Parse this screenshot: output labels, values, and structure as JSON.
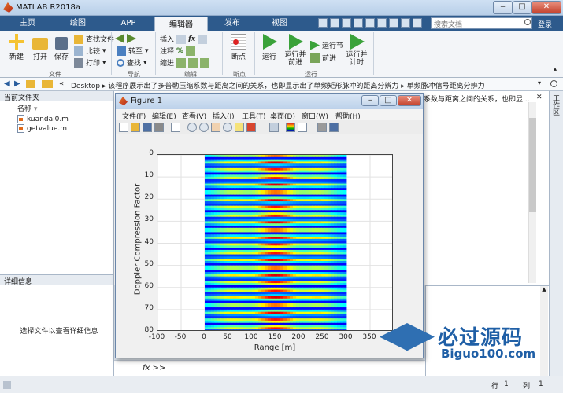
{
  "window": {
    "title": "MATLAB R2018a"
  },
  "tabs": [
    {
      "label": "主页"
    },
    {
      "label": "绘图"
    },
    {
      "label": "APP"
    },
    {
      "label": "编辑器"
    },
    {
      "label": "发布"
    },
    {
      "label": "视图"
    }
  ],
  "search": {
    "placeholder": "搜索文档"
  },
  "login": "登录",
  "ribbon": {
    "new": "新建",
    "open": "打开",
    "save": "保存",
    "find_files": "查找文件",
    "compare": "比较",
    "print": "打印",
    "goto": "转至",
    "find": "查找",
    "insert": "插入",
    "comment": "注释",
    "indent": "缩进",
    "breakpoints": "断点",
    "run": "运行",
    "run_advance": "运行并\n前进",
    "run_section": "运行节",
    "advance": "前进",
    "run_time": "运行并\n计时",
    "groups": {
      "file": "文件",
      "nav": "导航",
      "edit": "编辑",
      "bp": "断点",
      "run": "运行"
    }
  },
  "address": {
    "root": "Desktop",
    "seg1": "该程序展示出了多普勒压缩系数与距离之间的关系，也即显示出了单频矩形脉冲的距离分辨力",
    "seg2": "单频脉冲信号距离分辨力"
  },
  "left": {
    "title": "当前文件夹",
    "col_name": "名称",
    "files": [
      "kuandai0.m",
      "getvalue.m"
    ],
    "details_title": "详细信息",
    "details_hint": "选择文件以查看详细信息"
  },
  "editor_tail": "系数与距离之间的关系，也即显...",
  "sidebar_label": "工作区",
  "figure": {
    "title": "Figure 1",
    "menu": [
      "文件(F)",
      "编辑(E)",
      "查看(V)",
      "插入(I)",
      "工具(T)",
      "桌面(D)",
      "窗口(W)",
      "帮助(H)"
    ]
  },
  "chart_data": {
    "type": "heatmap",
    "xlabel": "Range [m]",
    "ylabel": "Doppler Compression Factor",
    "xlim": [
      -100,
      400
    ],
    "ylim": [
      0,
      80
    ],
    "x_ticks": [
      "-100",
      "-50",
      "0",
      "50",
      "100",
      "150",
      "200",
      "250",
      "300",
      "350",
      "400"
    ],
    "y_ticks": [
      "0",
      "10",
      "20",
      "30",
      "40",
      "50",
      "60",
      "70",
      "80"
    ],
    "y_reversed": true,
    "data_x_range": [
      0,
      300
    ],
    "colormap": "jet",
    "grid": true
  },
  "cmd": {
    "prompt": "fx >>"
  },
  "status": {
    "row_label": "行",
    "row": "1",
    "col_label": "列",
    "col": "1"
  },
  "watermark": {
    "cn": "必过源码",
    "en": "Biguo100.com"
  }
}
